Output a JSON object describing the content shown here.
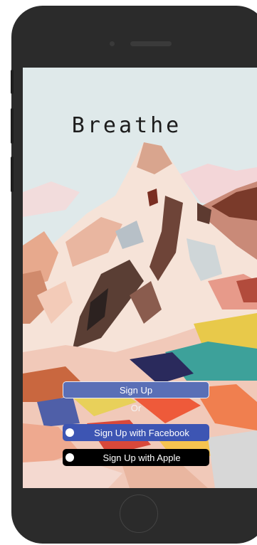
{
  "app": {
    "title": "Breathe"
  },
  "auth": {
    "signup_label": "Sign Up",
    "or_label": "Or",
    "facebook_label": "Sign Up with Facebook",
    "apple_label": "Sign Up with Apple"
  },
  "colors": {
    "sky": "#dfe9ea",
    "signup_button": "#5a6fb6",
    "facebook_button": "#3d55b3",
    "apple_button": "#000000"
  },
  "icons": {
    "facebook": "radio-dot-icon",
    "apple": "radio-dot-icon"
  }
}
